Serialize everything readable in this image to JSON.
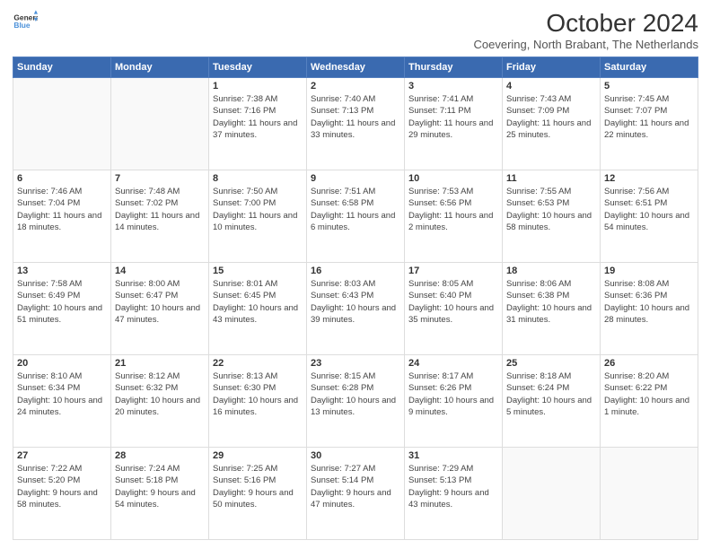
{
  "logo": {
    "general": "General",
    "blue": "Blue"
  },
  "title": "October 2024",
  "subtitle": "Coevering, North Brabant, The Netherlands",
  "days_of_week": [
    "Sunday",
    "Monday",
    "Tuesday",
    "Wednesday",
    "Thursday",
    "Friday",
    "Saturday"
  ],
  "weeks": [
    [
      {
        "day": "",
        "info": ""
      },
      {
        "day": "",
        "info": ""
      },
      {
        "day": "1",
        "info": "Sunrise: 7:38 AM\nSunset: 7:16 PM\nDaylight: 11 hours and 37 minutes."
      },
      {
        "day": "2",
        "info": "Sunrise: 7:40 AM\nSunset: 7:13 PM\nDaylight: 11 hours and 33 minutes."
      },
      {
        "day": "3",
        "info": "Sunrise: 7:41 AM\nSunset: 7:11 PM\nDaylight: 11 hours and 29 minutes."
      },
      {
        "day": "4",
        "info": "Sunrise: 7:43 AM\nSunset: 7:09 PM\nDaylight: 11 hours and 25 minutes."
      },
      {
        "day": "5",
        "info": "Sunrise: 7:45 AM\nSunset: 7:07 PM\nDaylight: 11 hours and 22 minutes."
      }
    ],
    [
      {
        "day": "6",
        "info": "Sunrise: 7:46 AM\nSunset: 7:04 PM\nDaylight: 11 hours and 18 minutes."
      },
      {
        "day": "7",
        "info": "Sunrise: 7:48 AM\nSunset: 7:02 PM\nDaylight: 11 hours and 14 minutes."
      },
      {
        "day": "8",
        "info": "Sunrise: 7:50 AM\nSunset: 7:00 PM\nDaylight: 11 hours and 10 minutes."
      },
      {
        "day": "9",
        "info": "Sunrise: 7:51 AM\nSunset: 6:58 PM\nDaylight: 11 hours and 6 minutes."
      },
      {
        "day": "10",
        "info": "Sunrise: 7:53 AM\nSunset: 6:56 PM\nDaylight: 11 hours and 2 minutes."
      },
      {
        "day": "11",
        "info": "Sunrise: 7:55 AM\nSunset: 6:53 PM\nDaylight: 10 hours and 58 minutes."
      },
      {
        "day": "12",
        "info": "Sunrise: 7:56 AM\nSunset: 6:51 PM\nDaylight: 10 hours and 54 minutes."
      }
    ],
    [
      {
        "day": "13",
        "info": "Sunrise: 7:58 AM\nSunset: 6:49 PM\nDaylight: 10 hours and 51 minutes."
      },
      {
        "day": "14",
        "info": "Sunrise: 8:00 AM\nSunset: 6:47 PM\nDaylight: 10 hours and 47 minutes."
      },
      {
        "day": "15",
        "info": "Sunrise: 8:01 AM\nSunset: 6:45 PM\nDaylight: 10 hours and 43 minutes."
      },
      {
        "day": "16",
        "info": "Sunrise: 8:03 AM\nSunset: 6:43 PM\nDaylight: 10 hours and 39 minutes."
      },
      {
        "day": "17",
        "info": "Sunrise: 8:05 AM\nSunset: 6:40 PM\nDaylight: 10 hours and 35 minutes."
      },
      {
        "day": "18",
        "info": "Sunrise: 8:06 AM\nSunset: 6:38 PM\nDaylight: 10 hours and 31 minutes."
      },
      {
        "day": "19",
        "info": "Sunrise: 8:08 AM\nSunset: 6:36 PM\nDaylight: 10 hours and 28 minutes."
      }
    ],
    [
      {
        "day": "20",
        "info": "Sunrise: 8:10 AM\nSunset: 6:34 PM\nDaylight: 10 hours and 24 minutes."
      },
      {
        "day": "21",
        "info": "Sunrise: 8:12 AM\nSunset: 6:32 PM\nDaylight: 10 hours and 20 minutes."
      },
      {
        "day": "22",
        "info": "Sunrise: 8:13 AM\nSunset: 6:30 PM\nDaylight: 10 hours and 16 minutes."
      },
      {
        "day": "23",
        "info": "Sunrise: 8:15 AM\nSunset: 6:28 PM\nDaylight: 10 hours and 13 minutes."
      },
      {
        "day": "24",
        "info": "Sunrise: 8:17 AM\nSunset: 6:26 PM\nDaylight: 10 hours and 9 minutes."
      },
      {
        "day": "25",
        "info": "Sunrise: 8:18 AM\nSunset: 6:24 PM\nDaylight: 10 hours and 5 minutes."
      },
      {
        "day": "26",
        "info": "Sunrise: 8:20 AM\nSunset: 6:22 PM\nDaylight: 10 hours and 1 minute."
      }
    ],
    [
      {
        "day": "27",
        "info": "Sunrise: 7:22 AM\nSunset: 5:20 PM\nDaylight: 9 hours and 58 minutes."
      },
      {
        "day": "28",
        "info": "Sunrise: 7:24 AM\nSunset: 5:18 PM\nDaylight: 9 hours and 54 minutes."
      },
      {
        "day": "29",
        "info": "Sunrise: 7:25 AM\nSunset: 5:16 PM\nDaylight: 9 hours and 50 minutes."
      },
      {
        "day": "30",
        "info": "Sunrise: 7:27 AM\nSunset: 5:14 PM\nDaylight: 9 hours and 47 minutes."
      },
      {
        "day": "31",
        "info": "Sunrise: 7:29 AM\nSunset: 5:13 PM\nDaylight: 9 hours and 43 minutes."
      },
      {
        "day": "",
        "info": ""
      },
      {
        "day": "",
        "info": ""
      }
    ]
  ]
}
